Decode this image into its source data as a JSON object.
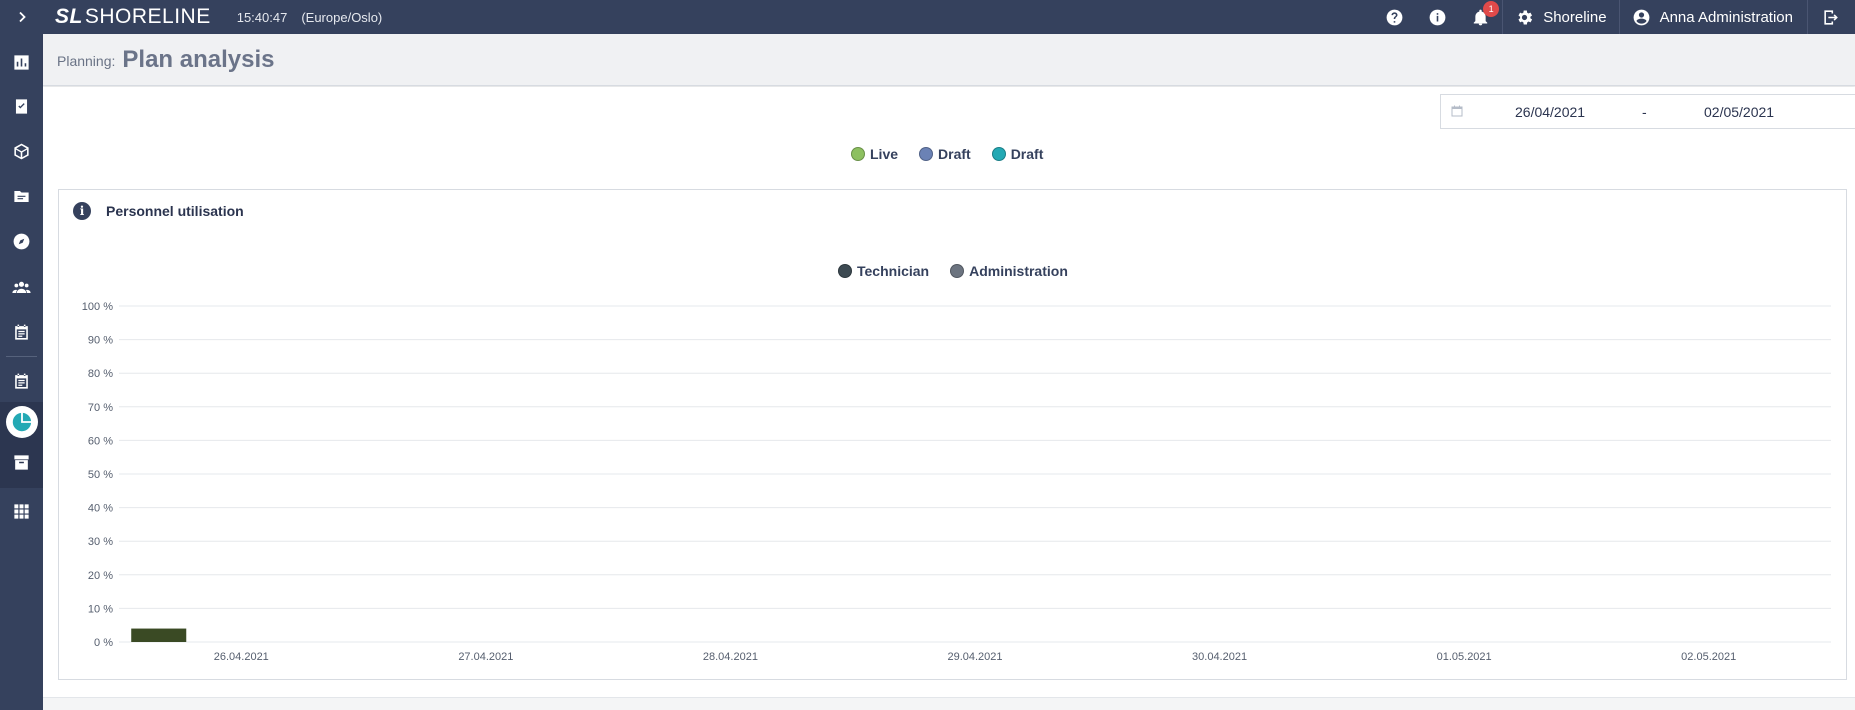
{
  "app": {
    "logo_mark": "SL",
    "logo_text": "SHORELINE",
    "clock": "15:40:47",
    "timezone": "(Europe/Oslo)"
  },
  "topbar": {
    "notification_count": "1",
    "company": "Shoreline",
    "user": "Anna Administration"
  },
  "sidebar": {
    "expand_icon": "chevron-right-icon",
    "items": [
      {
        "icon": "bar-chart-icon"
      },
      {
        "icon": "checklist-icon"
      },
      {
        "icon": "package-icon"
      },
      {
        "icon": "folder-icon"
      },
      {
        "icon": "compass-icon"
      },
      {
        "icon": "people-icon"
      },
      {
        "icon": "calendar-list-icon"
      },
      {
        "icon": "calendar-list-icon"
      },
      {
        "icon": "pie-chart-icon",
        "active": true
      },
      {
        "icon": "archive-icon"
      },
      {
        "icon": "apps-grid-icon"
      }
    ]
  },
  "header": {
    "crumb": "Planning:",
    "title": "Plan analysis"
  },
  "date_range": {
    "from": "26/04/2021",
    "separator": "-",
    "to": "02/05/2021"
  },
  "plan_legend": [
    {
      "label": "Live",
      "color": "#8dc060"
    },
    {
      "label": "Draft",
      "color": "#6b82b5"
    },
    {
      "label": "Draft",
      "color": "#23a9b4"
    }
  ],
  "panel": {
    "title": "Personnel utilisation"
  },
  "colors": {
    "sidebar": "#35415d",
    "accent": "#23a9b4",
    "technician": "#3d4a52",
    "administration": "#6c7480",
    "bar": "#3a4a24"
  },
  "chart_data": {
    "type": "bar",
    "categories": [
      "26.04.2021",
      "27.04.2021",
      "28.04.2021",
      "29.04.2021",
      "30.04.2021",
      "01.05.2021",
      "02.05.2021"
    ],
    "series": [
      {
        "name": "Technician",
        "values": [
          4,
          0,
          0,
          0,
          0,
          0,
          0
        ]
      },
      {
        "name": "Administration",
        "values": [
          0,
          0,
          0,
          0,
          0,
          0,
          0
        ]
      }
    ],
    "yticks": [
      "0 %",
      "10 %",
      "20 %",
      "30 %",
      "40 %",
      "50 %",
      "60 %",
      "70 %",
      "80 %",
      "90 %",
      "100 %"
    ],
    "ylim": [
      0,
      100
    ],
    "grid": true,
    "legend": "top-center"
  }
}
